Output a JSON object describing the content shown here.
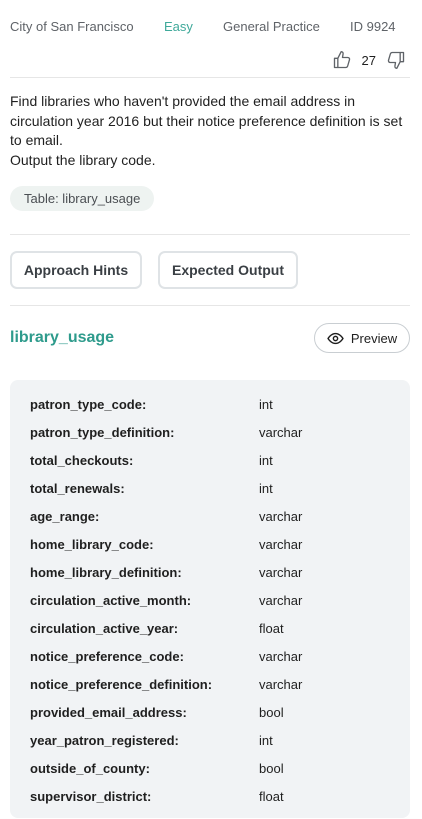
{
  "meta": {
    "city": "City of San Francisco",
    "difficulty": "Easy",
    "category": "General Practice",
    "id": "ID 9924"
  },
  "votes": {
    "upvote_icon": "thumbs-up-icon",
    "count": "27",
    "downvote_icon": "thumbs-down-icon"
  },
  "question": {
    "line1": "Find libraries who haven't provided the email address in circulation year 2016 but their notice preference definition is set to email.",
    "line2": "Output the library code."
  },
  "table_chip": "Table: library_usage",
  "buttons": {
    "hints": "Approach Hints",
    "output": "Expected Output"
  },
  "table": {
    "name": "library_usage",
    "preview_label": "Preview",
    "preview_icon": "eye-icon"
  },
  "schema": [
    {
      "column": "patron_type_code:",
      "type": "int"
    },
    {
      "column": "patron_type_definition:",
      "type": "varchar"
    },
    {
      "column": "total_checkouts:",
      "type": "int"
    },
    {
      "column": "total_renewals:",
      "type": "int"
    },
    {
      "column": "age_range:",
      "type": "varchar"
    },
    {
      "column": "home_library_code:",
      "type": "varchar"
    },
    {
      "column": "home_library_definition:",
      "type": "varchar"
    },
    {
      "column": "circulation_active_month:",
      "type": "varchar"
    },
    {
      "column": "circulation_active_year:",
      "type": "float"
    },
    {
      "column": "notice_preference_code:",
      "type": "varchar"
    },
    {
      "column": "notice_preference_definition:",
      "type": "varchar"
    },
    {
      "column": "provided_email_address:",
      "type": "bool"
    },
    {
      "column": "year_patron_registered:",
      "type": "int"
    },
    {
      "column": "outside_of_county:",
      "type": "bool"
    },
    {
      "column": "supervisor_district:",
      "type": "float"
    }
  ],
  "colors": {
    "accent": "#2e9b8c",
    "difficulty": "#3fa99a",
    "schema_bg": "#f1f3f5",
    "chip_bg": "#eef3f1"
  }
}
